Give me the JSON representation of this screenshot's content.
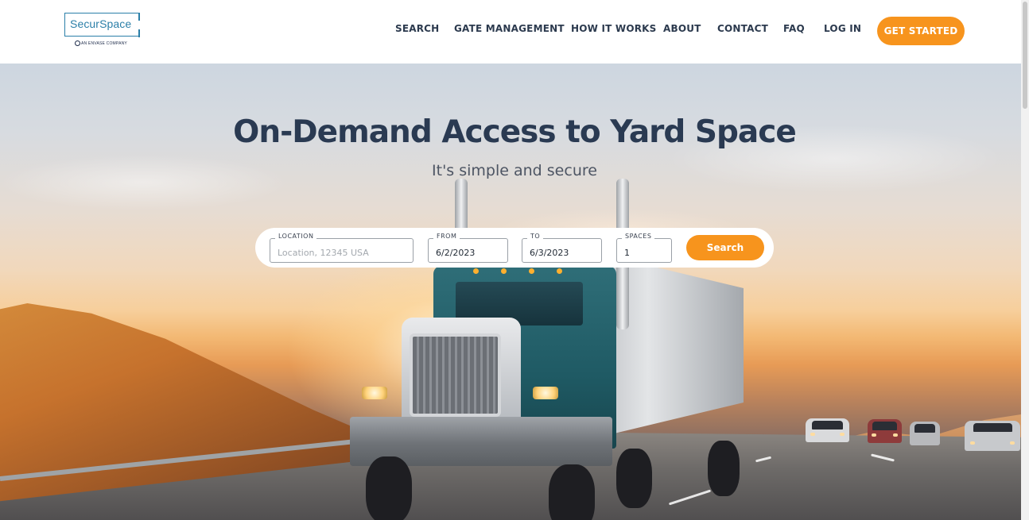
{
  "brand": {
    "name": "SecurSpace",
    "tagline": "AN ENVASE COMPANY"
  },
  "nav": {
    "items": [
      {
        "label": "SEARCH"
      },
      {
        "label": "GATE MANAGEMENT"
      },
      {
        "label": "HOW IT WORKS"
      },
      {
        "label": "ABOUT"
      },
      {
        "label": "CONTACT"
      },
      {
        "label": "FAQ"
      },
      {
        "label": "LOG IN"
      }
    ],
    "cta_label": "GET STARTED"
  },
  "hero": {
    "title": "On-Demand Access to Yard Space",
    "subtitle": "It's simple and secure"
  },
  "search": {
    "location_label": "LOCATION",
    "location_placeholder": "Location, 12345 USA",
    "location_value": "",
    "from_label": "FROM",
    "from_value": "6/2/2023",
    "to_label": "TO",
    "to_value": "6/3/2023",
    "spaces_label": "SPACES",
    "spaces_value": "1",
    "button_label": "Search"
  },
  "colors": {
    "accent": "#f7941d",
    "brand": "#2b7fa8",
    "heading": "#2a3a52",
    "nav_text": "#2c3a4e"
  }
}
